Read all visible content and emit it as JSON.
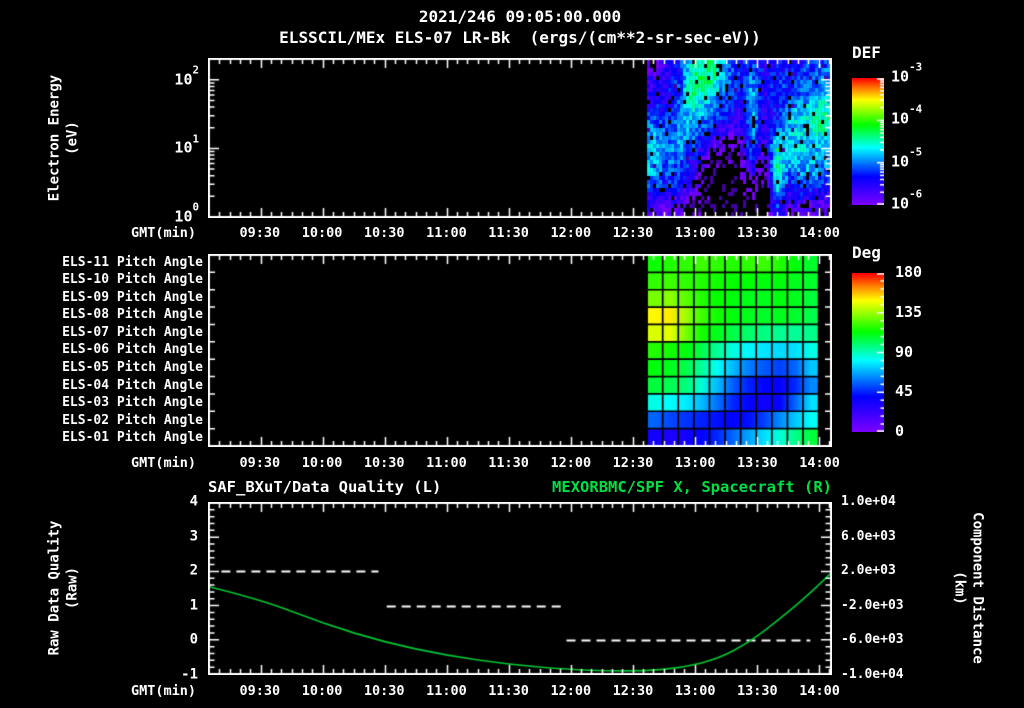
{
  "header": {
    "datetime": "2021/246 09:05:00.000",
    "title": "ELSSCIL/MEx ELS-07 LR-Bk  (ergs/(cm**2-sr-sec-eV))"
  },
  "colors": {
    "background": "#000000",
    "foreground": "#ffffff",
    "title_green": "#00e044",
    "curve_green": "#00c832",
    "rainbow_low_to_high": [
      "#7a00ff",
      "#0000ff",
      "#00ffff",
      "#00ff00",
      "#ffff00",
      "#ff8000",
      "#ff0000"
    ]
  },
  "time_axis": {
    "label": "GMT(min)",
    "start": "09:05",
    "end": "14:06",
    "major_ticks": [
      "09:30",
      "10:00",
      "10:30",
      "11:00",
      "11:30",
      "12:00",
      "12:30",
      "13:00",
      "13:30",
      "14:00"
    ],
    "minor_step_min": 5,
    "major_step_min": 30
  },
  "panel_energy": {
    "y_label_line1": "Electron Energy",
    "y_label_line2": "(eV)",
    "y_tick_base": "10",
    "y_tick_exponents": [
      "2",
      "1",
      "0"
    ],
    "colorbar": {
      "title": "DEF",
      "tick_base": "10",
      "tick_exponents": [
        "-3",
        "-4",
        "-5",
        "-6"
      ]
    }
  },
  "panel_pitch": {
    "row_labels": [
      "ELS-11 Pitch Angle",
      "ELS-10 Pitch Angle",
      "ELS-09 Pitch Angle",
      "ELS-08 Pitch Angle",
      "ELS-07 Pitch Angle",
      "ELS-06 Pitch Angle",
      "ELS-05 Pitch Angle",
      "ELS-04 Pitch Angle",
      "ELS-03 Pitch Angle",
      "ELS-02 Pitch Angle",
      "ELS-01 Pitch Angle"
    ],
    "colorbar": {
      "title": "Deg",
      "ticks": [
        "180",
        "135",
        "90",
        "45",
        "0"
      ]
    }
  },
  "panel_bottom": {
    "title_left": "SAF_BXuT/Data Quality (L)",
    "title_right": "MEXORBMC/SPF X, Spacecraft (R)",
    "y_left_label_line1": "Raw Data Quality",
    "y_left_label_line2": "(Raw)",
    "y_left_ticks": [
      "4",
      "3",
      "2",
      "1",
      "0",
      "-1"
    ],
    "y_right_label_line1": "Component Distance",
    "y_right_label_line2": "(km)",
    "y_right_ticks": [
      "1.0e+04",
      "6.0e+03",
      "2.0e+03",
      "-2.0e+03",
      "-6.0e+03",
      "-1.0e+04"
    ]
  },
  "chart_data": [
    {
      "type": "heatmap",
      "name": "electron_energy_spectrogram",
      "title": "ELSSCIL/MEx ELS-07 LR-Bk",
      "units": "ergs/(cm**2-sr-sec-eV)",
      "x_range": [
        "09:05",
        "14:06"
      ],
      "data_start": "12:37",
      "data_end": "14:06",
      "y_scale": "log",
      "y_range_ev": [
        1,
        215
      ],
      "value_scale": "log10",
      "colorbar_range_log10": [
        -3,
        -6
      ],
      "no_data_value": -7,
      "values_log10": [
        [
          -6.3,
          -5.8,
          -5.6,
          -4.8,
          -4.5,
          -4.6,
          -5.2,
          -5.6,
          -5.4,
          -5.7,
          -5.6,
          -5.6,
          -5.5,
          -5.4,
          -5.3
        ],
        [
          -5.9,
          -5.7,
          -5.5,
          -4.5,
          -4.4,
          -4.7,
          -5.3,
          -5.5,
          -5.1,
          -5.7,
          -5.5,
          -5.5,
          -5.4,
          -5.3,
          -5.2
        ],
        [
          -5.8,
          -5.7,
          -5.4,
          -4.5,
          -4.6,
          -5.0,
          -5.4,
          -5.6,
          -5.0,
          -5.8,
          -5.5,
          -5.4,
          -5.3,
          -5.1,
          -5.0
        ],
        [
          -5.6,
          -5.6,
          -5.3,
          -4.8,
          -5.0,
          -5.3,
          -5.5,
          -5.7,
          -5.0,
          -5.8,
          -5.6,
          -5.2,
          -5.0,
          -4.9,
          -4.7
        ],
        [
          -5.3,
          -5.5,
          -5.2,
          -5.0,
          -5.2,
          -5.5,
          -5.6,
          -5.9,
          -5.0,
          -5.9,
          -5.6,
          -5.0,
          -4.9,
          -4.8,
          -4.6
        ],
        [
          -5.1,
          -5.4,
          -5.1,
          -5.2,
          -5.5,
          -5.8,
          -6.0,
          -6.1,
          -5.1,
          -6.0,
          -5.2,
          -5.0,
          -4.9,
          -4.8,
          -4.7
        ],
        [
          -5.0,
          -5.3,
          -5.1,
          -5.4,
          -5.8,
          -6.2,
          -6.5,
          -6.3,
          -5.2,
          -6.2,
          -4.7,
          -5.0,
          -4.9,
          -5.0,
          -5.0
        ],
        [
          -5.0,
          -5.3,
          -5.2,
          -5.6,
          -6.0,
          -6.5,
          -6.7,
          -6.5,
          -5.4,
          -6.4,
          -4.6,
          -5.1,
          -5.0,
          -5.0,
          -5.1
        ],
        [
          -5.1,
          -5.4,
          -5.4,
          -5.8,
          -6.3,
          -6.7,
          -6.8,
          -6.6,
          -5.9,
          -6.6,
          -4.6,
          -5.2,
          -5.1,
          -5.1,
          -5.2
        ],
        [
          -5.4,
          -5.6,
          -5.6,
          -6.0,
          -6.5,
          -6.8,
          -6.8,
          -6.8,
          -6.3,
          -6.8,
          -4.8,
          -5.6,
          -5.4,
          -5.5,
          -5.6
        ],
        [
          -5.8,
          -5.9,
          -5.9,
          -6.3,
          -6.6,
          -6.8,
          -6.9,
          -6.9,
          -6.6,
          -6.9,
          -5.2,
          -6.0,
          -5.8,
          -5.9,
          -6.0
        ],
        [
          -6.1,
          -6.1,
          -6.2,
          -6.5,
          -6.8,
          -6.9,
          -6.9,
          -6.9,
          -6.8,
          -6.9,
          -5.5,
          -6.3,
          -6.1,
          -6.2,
          -6.3
        ]
      ]
    },
    {
      "type": "heatmap",
      "name": "pitch_angles",
      "rows": [
        "ELS-11",
        "ELS-10",
        "ELS-09",
        "ELS-08",
        "ELS-07",
        "ELS-06",
        "ELS-05",
        "ELS-04",
        "ELS-03",
        "ELS-02",
        "ELS-01"
      ],
      "x_range": [
        "09:05",
        "14:06"
      ],
      "data_start": "12:37",
      "data_end": "14:00",
      "units": "deg",
      "value_range": [
        0,
        180
      ],
      "values_deg": [
        [
          115,
          118,
          120,
          122,
          120,
          118,
          120,
          122,
          118,
          112,
          108
        ],
        [
          120,
          122,
          120,
          118,
          116,
          114,
          113,
          112,
          112,
          110,
          108
        ],
        [
          130,
          133,
          126,
          118,
          114,
          112,
          110,
          110,
          112,
          110,
          106
        ],
        [
          150,
          152,
          136,
          122,
          116,
          112,
          110,
          108,
          110,
          108,
          104
        ],
        [
          144,
          146,
          130,
          116,
          110,
          104,
          100,
          97,
          95,
          94,
          96
        ],
        [
          118,
          116,
          112,
          104,
          94,
          85,
          80,
          77,
          75,
          76,
          84
        ],
        [
          112,
          110,
          104,
          94,
          82,
          70,
          60,
          54,
          50,
          56,
          72
        ],
        [
          106,
          103,
          98,
          86,
          70,
          55,
          45,
          40,
          38,
          46,
          62
        ],
        [
          84,
          81,
          78,
          70,
          58,
          46,
          40,
          34,
          38,
          56,
          76
        ],
        [
          56,
          51,
          48,
          45,
          42,
          40,
          42,
          50,
          62,
          72,
          82
        ],
        [
          34,
          30,
          33,
          39,
          46,
          56,
          66,
          76,
          86,
          96,
          106
        ]
      ]
    },
    {
      "type": "line",
      "name": "quality_and_spacecraft_distance",
      "left_axis": {
        "label": "Raw Data Quality (Raw)",
        "range": [
          -1,
          4
        ]
      },
      "right_axis": {
        "label": "Component Distance (km)",
        "range": [
          -10000,
          10000
        ]
      },
      "series": [
        {
          "name": "SAF_BXuT/Data Quality (L)",
          "axis": "left",
          "style": "dashed_white_steps",
          "steps": [
            {
              "quality": 2,
              "from": "09:11",
              "to": "10:27"
            },
            {
              "quality": 1,
              "from": "10:31",
              "to": "11:56"
            },
            {
              "quality": 0,
              "from": "11:58",
              "to": "13:56"
            }
          ]
        },
        {
          "name": "MEXORBMC/SPF X, Spacecraft (R)",
          "axis": "right",
          "style": "solid_green",
          "points_frac_km": [
            [
              0.0,
              200
            ],
            [
              0.083,
              -1280
            ],
            [
              0.184,
              -4120
            ],
            [
              0.284,
              -6320
            ],
            [
              0.38,
              -7800
            ],
            [
              0.48,
              -8880
            ],
            [
              0.58,
              -9480
            ],
            [
              0.64,
              -9640
            ],
            [
              0.7,
              -9640
            ],
            [
              0.76,
              -9280
            ],
            [
              0.82,
              -8200
            ],
            [
              0.87,
              -6200
            ],
            [
              0.91,
              -4000
            ],
            [
              0.95,
              -1600
            ],
            [
              0.98,
              400
            ],
            [
              1.0,
              1800
            ]
          ]
        }
      ]
    }
  ]
}
